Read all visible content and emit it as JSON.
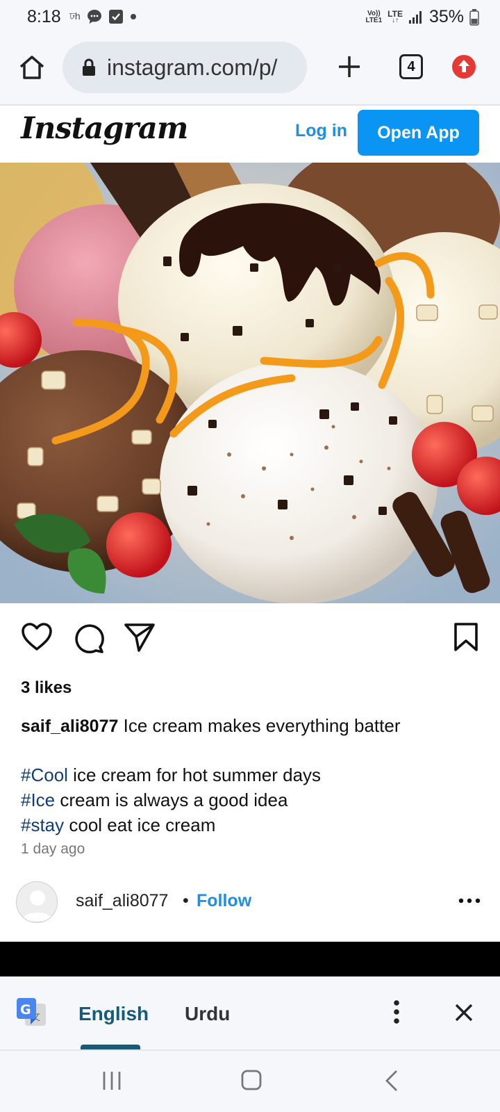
{
  "status_bar": {
    "time": "8:18",
    "network_top": "Vo))",
    "network_bottom": "LTE1",
    "lte_label": "LTE",
    "battery": "35%"
  },
  "browser": {
    "url": "instagram.com/p/",
    "tab_count": "4",
    "icons": [
      "home-icon",
      "lock-icon",
      "plus-icon",
      "tabs-icon",
      "update-icon"
    ]
  },
  "header": {
    "logo": "Instagram",
    "login_label": "Log in",
    "open_app_label": "Open App"
  },
  "post": {
    "likes": "3 likes",
    "caption": {
      "username": "saif_ali8077",
      "text": "Ice cream makes everything batter",
      "lines": [
        {
          "tag": "#Cool",
          "text": " ice cream for hot summer days"
        },
        {
          "tag": "#Ice",
          "text": " cream is always a good idea"
        },
        {
          "tag": "#stay",
          "text": " cool eat ice cream"
        }
      ]
    },
    "time_ago": "1 day ago",
    "owner": {
      "username": "saif_ali8077",
      "separator": "•",
      "follow_label": "Follow"
    }
  },
  "translate_bar": {
    "lang_selected": "English",
    "lang_other": "Urdu"
  },
  "colors": {
    "accent": "#0a95f5",
    "link": "#1d90e2",
    "hashtag": "#123d75",
    "translate_accent": "#135c7a"
  }
}
